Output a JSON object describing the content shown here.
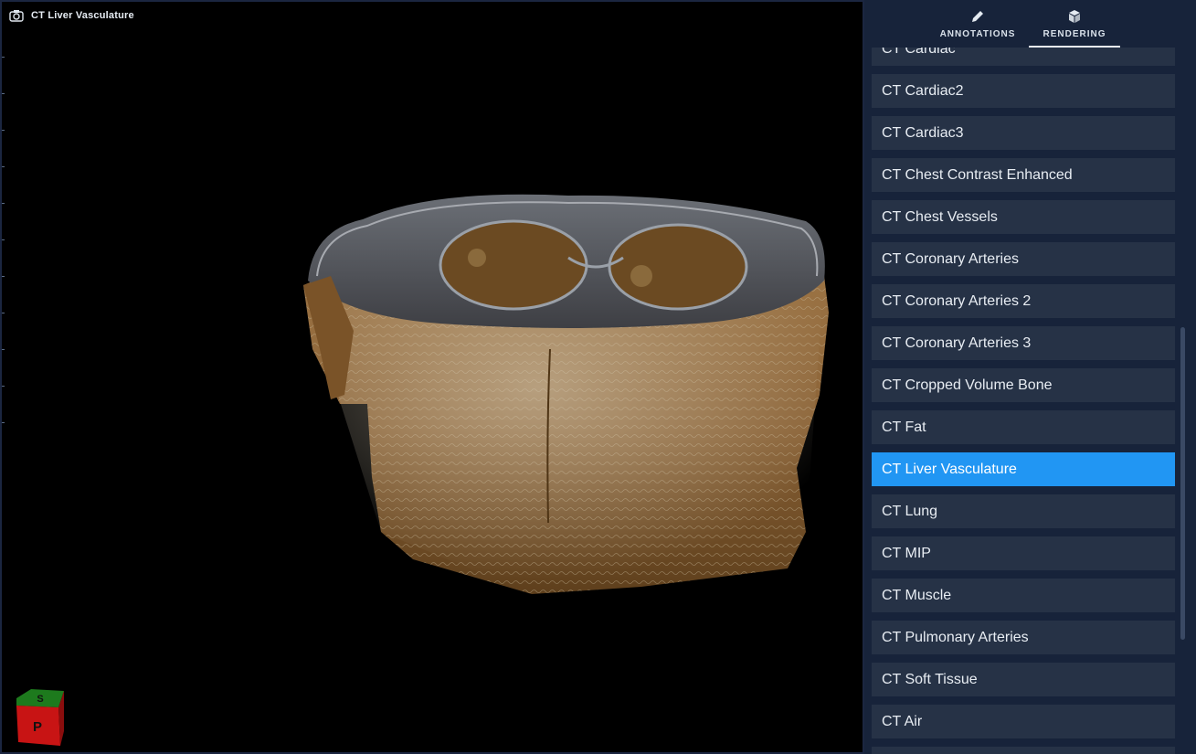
{
  "viewport": {
    "title": "CT Liver Vasculature",
    "camera_icon": "camera-icon",
    "orientation_cube": {
      "top_label": "S",
      "front_label": "P"
    }
  },
  "panel": {
    "tabs": [
      {
        "label": "ANNOTATIONS",
        "icon": "pencil-icon",
        "active": false
      },
      {
        "label": "RENDERING",
        "icon": "cube-icon",
        "active": true
      }
    ],
    "presets": [
      "CT Cardiac",
      "CT Cardiac2",
      "CT Cardiac3",
      "CT Chest Contrast Enhanced",
      "CT Chest Vessels",
      "CT Coronary Arteries",
      "CT Coronary Arteries 2",
      "CT Coronary Arteries 3",
      "CT Cropped Volume Bone",
      "CT Fat",
      "CT Liver Vasculature",
      "CT Lung",
      "CT MIP",
      "CT Muscle",
      "CT Pulmonary Arteries",
      "CT Soft Tissue",
      "CT Air",
      ""
    ],
    "selected_preset": "CT Liver Vasculature"
  },
  "colors": {
    "accent": "#2196f3",
    "panel_bg": "#17233a",
    "item_bg": "#263246"
  }
}
